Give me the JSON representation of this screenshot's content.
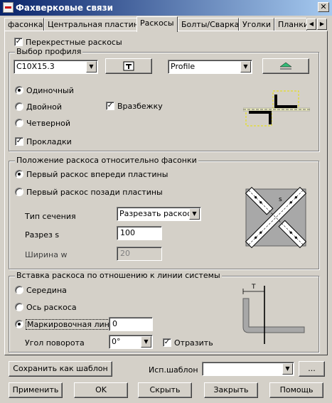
{
  "window": {
    "title": "Фахверковые связи",
    "close_label": "✕"
  },
  "tabs": [
    {
      "label": "фасонка"
    },
    {
      "label": "Центральная пластина"
    },
    {
      "label": "Раскосы"
    },
    {
      "label": "Болты/Сварка"
    },
    {
      "label": "Уголки"
    },
    {
      "label": "Планки"
    }
  ],
  "active_tab": "Раскосы",
  "tab_scroll": {
    "left": "◀",
    "right": "▶"
  },
  "cross_braces": {
    "label": "Перекрестные раскосы",
    "checked": true
  },
  "profile_group": {
    "title": "Выбор профиля",
    "profile_value": "C10X15.3",
    "type_value": "Profile",
    "options": [
      {
        "label": "Одиночный",
        "selected": true
      },
      {
        "label": "Двойной",
        "selected": false
      },
      {
        "label": "Четверной",
        "selected": false
      }
    ],
    "staggered": {
      "label": "Вразбежку",
      "checked": true
    },
    "gaskets": {
      "label": "Прокладки",
      "checked": true
    }
  },
  "position_group": {
    "title": "Положение раскоса относительно фасонки",
    "options": [
      {
        "label": "Первый раскос впереди пластины",
        "selected": true
      },
      {
        "label": "Первый раскос позади пластины",
        "selected": false
      }
    ],
    "section_type_label": "Тип сечения",
    "section_type_value": "Разрезать раскосы",
    "cut_label": "Разрез s",
    "cut_value": "100",
    "width_label": "Ширина w",
    "width_value": "20"
  },
  "insertion_group": {
    "title": "Вставка раскоса по отношению к линии системы",
    "options": [
      {
        "label": "Середина",
        "selected": false
      },
      {
        "label": "Ось раскоса",
        "selected": false
      },
      {
        "label": "Маркировочная линия",
        "selected": true
      }
    ],
    "mark_value": "0",
    "rotation_label": "Угол поворота",
    "rotation_value": "0°",
    "mirror": {
      "label": "Отразить",
      "checked": true
    },
    "diagram_t_label": "T"
  },
  "diagram_labels": {
    "s": "s"
  },
  "template": {
    "save_label": "Сохранить как шаблон",
    "use_label": "Исп.шаблон",
    "use_value": "",
    "browse_label": "..."
  },
  "buttons": {
    "apply": "Применить",
    "ok": "OK",
    "hide": "Скрыть",
    "close": "Закрыть",
    "help": "Помощь"
  },
  "check_mark": "✓",
  "dropdown_glyph": "▼"
}
